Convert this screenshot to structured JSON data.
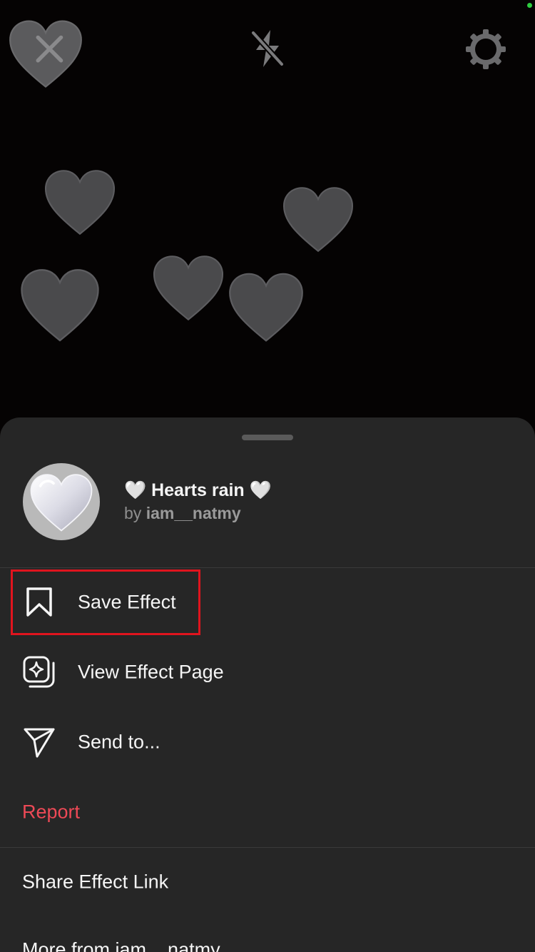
{
  "status": {
    "indicator_color": "#2ecc40"
  },
  "camera_toolbar": {
    "close_icon": "close-x-icon",
    "flash_icon": "flash-off-icon",
    "settings_icon": "gear-icon"
  },
  "effect": {
    "title": "🤍 Hearts rain 🤍",
    "by_label": "by",
    "author": "iam__natmy",
    "thumbnail_icon": "heart-icon"
  },
  "menu": {
    "save_label": "Save Effect",
    "save_icon": "bookmark-icon",
    "view_page_label": "View Effect Page",
    "view_page_icon": "effect-page-icon",
    "send_label": "Send to...",
    "send_icon": "paper-plane-icon",
    "report_label": "Report",
    "share_link_label": "Share Effect Link",
    "more_from_label": "More from iam__natmy"
  },
  "colors": {
    "sheet_background": "#262626",
    "report_text": "#ed4956",
    "highlight_border": "#e0141e"
  }
}
